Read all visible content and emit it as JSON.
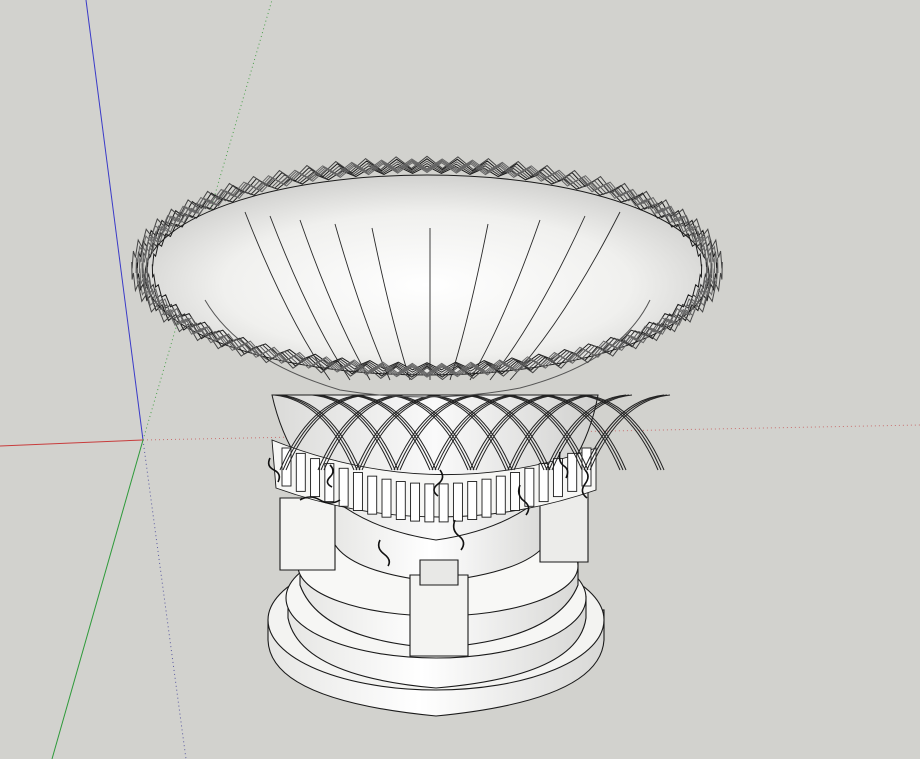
{
  "viewport": {
    "background": "#d2d2ce",
    "model": "wicker-basket-planter-on-pedestal"
  },
  "axes": {
    "x_axis_color": "#c83c3c",
    "y_axis_color": "#2e9a3a",
    "z_axis_color": "#3a3ac8"
  },
  "colors": {
    "face": "#f2f2f0",
    "face_shade": "#dcdcda",
    "face_dark": "#bcbcba",
    "edge": "#1a1a1a"
  }
}
